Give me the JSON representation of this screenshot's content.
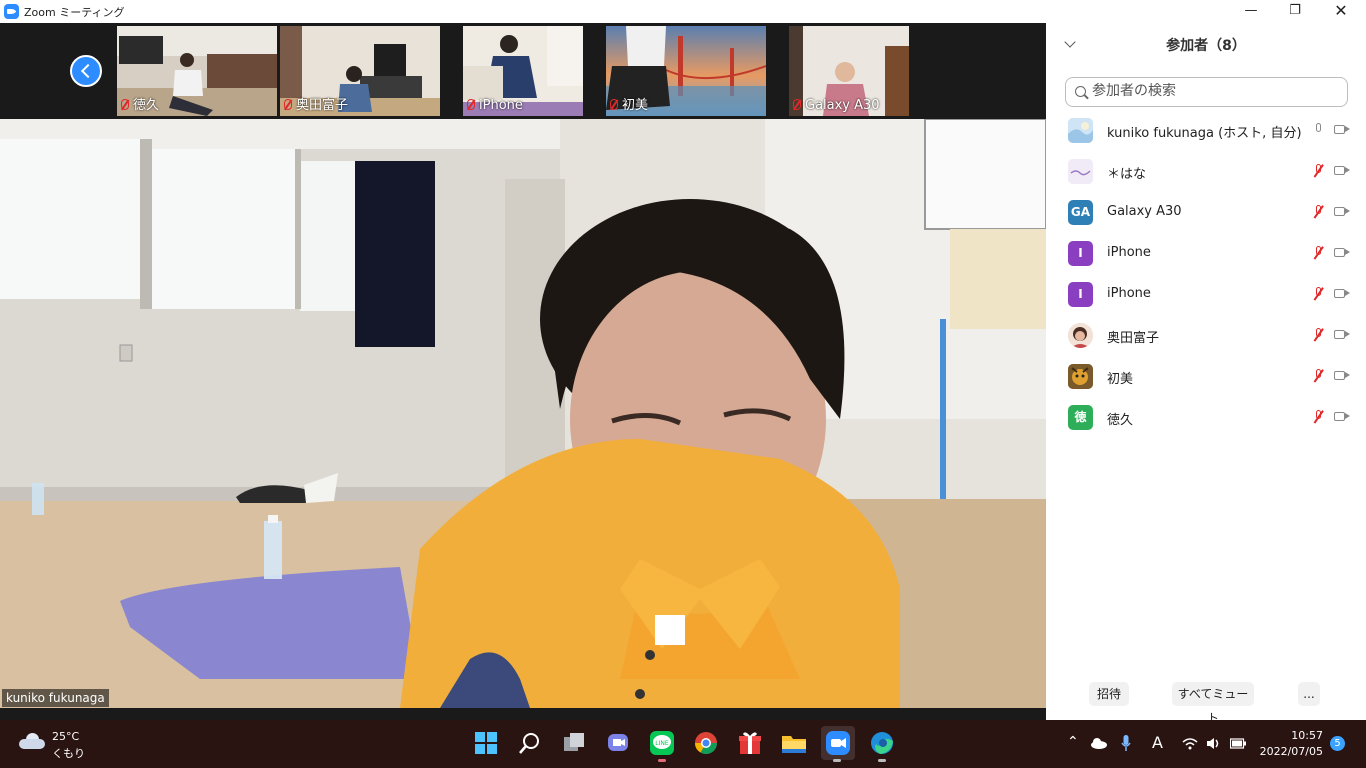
{
  "window": {
    "title": "Zoom ミーティング"
  },
  "thumbnails": [
    {
      "label": "徳久",
      "muted": true
    },
    {
      "label": "奥田富子",
      "muted": true
    },
    {
      "label": "iPhone",
      "muted": true
    },
    {
      "label": "初美",
      "muted": true
    },
    {
      "label": "Galaxy A30",
      "muted": true
    }
  ],
  "main": {
    "speaker_name": "kuniko fukunaga"
  },
  "panel": {
    "title": "参加者（8）",
    "search_placeholder": "参加者の検索",
    "participants": [
      {
        "name": "kuniko fukunaga (ホスト, 自分)",
        "avatar_text": "",
        "avatar_color": "#bcd9f0",
        "muted": false
      },
      {
        "name": "＊はな",
        "avatar_text": "",
        "avatar_color": "#e9dff5",
        "muted": true
      },
      {
        "name": "Galaxy A30",
        "avatar_text": "GA",
        "avatar_color": "#2f7fb7",
        "muted": true
      },
      {
        "name": "iPhone",
        "avatar_text": "I",
        "avatar_color": "#8a3fc0",
        "muted": true
      },
      {
        "name": "iPhone",
        "avatar_text": "I",
        "avatar_color": "#8a3fc0",
        "muted": true
      },
      {
        "name": "奥田富子",
        "avatar_text": "",
        "avatar_color": "#e8c8b8",
        "muted": true
      },
      {
        "name": "初美",
        "avatar_text": "",
        "avatar_color": "#a87a3a",
        "muted": true
      },
      {
        "name": "徳久",
        "avatar_text": "徳",
        "avatar_color": "#2fae5a",
        "muted": true
      }
    ],
    "buttons": {
      "invite": "招待",
      "mute_all": "すべてミュート",
      "more": "..."
    }
  },
  "taskbar": {
    "weather_temp": "25°C",
    "weather_cond": "くもり",
    "time": "10:57",
    "date": "2022/07/05",
    "notification_count": "5",
    "ime_label": "A"
  },
  "colors": {
    "accent": "#2d8cff",
    "mute_red": "#e02828"
  }
}
